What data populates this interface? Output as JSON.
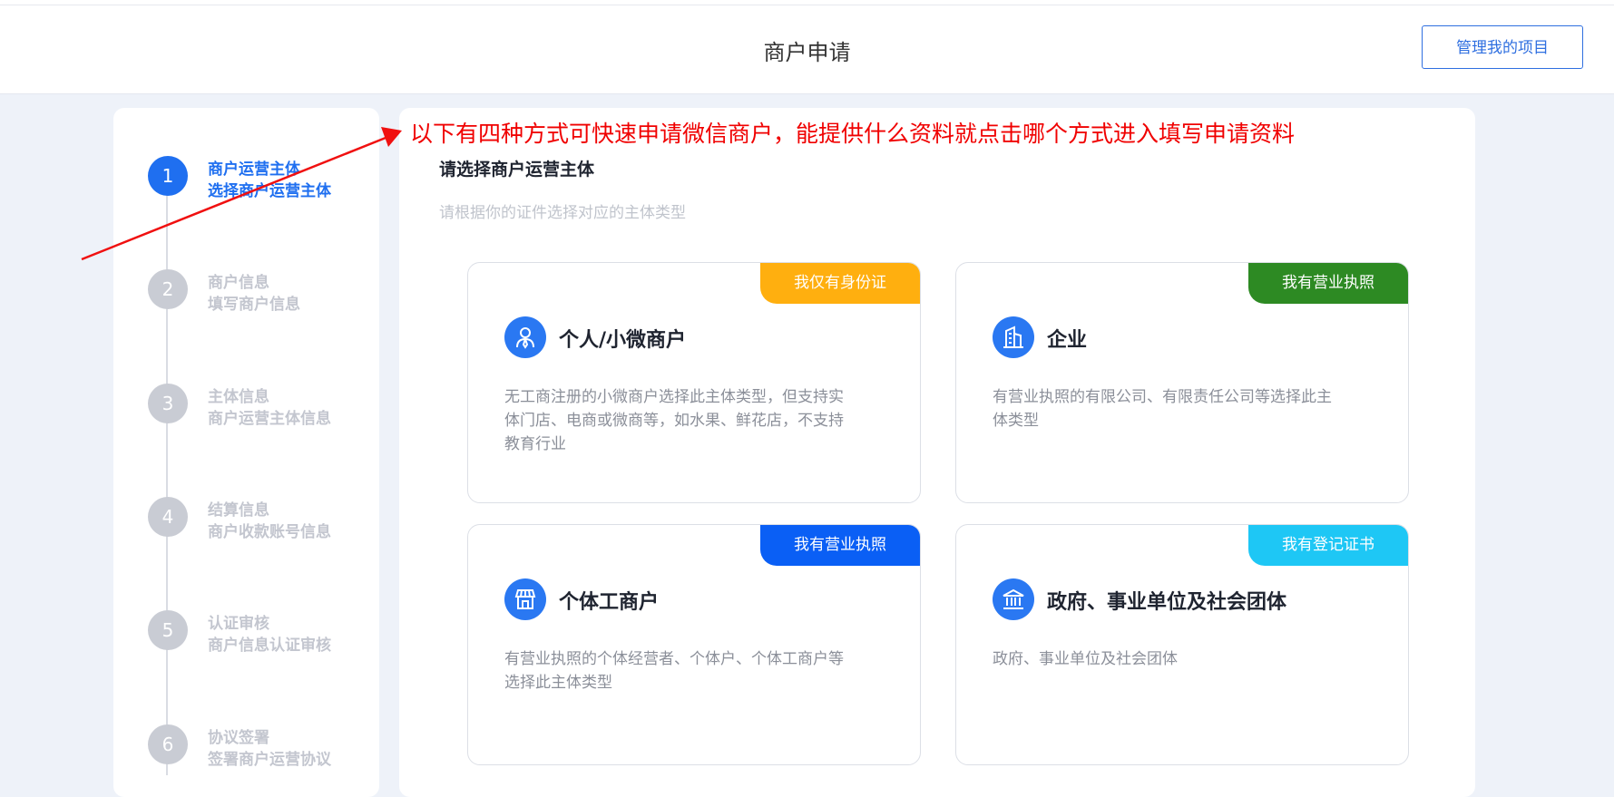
{
  "header": {
    "title": "商户申请",
    "manage_button": "管理我的项目"
  },
  "steps": [
    {
      "number": "1",
      "title": "商户运营主体",
      "subtitle": "选择商户运营主体",
      "active": true
    },
    {
      "number": "2",
      "title": "商户信息",
      "subtitle": "填写商户信息",
      "active": false
    },
    {
      "number": "3",
      "title": "主体信息",
      "subtitle": "商户运营主体信息",
      "active": false
    },
    {
      "number": "4",
      "title": "结算信息",
      "subtitle": "商户收款账号信息",
      "active": false
    },
    {
      "number": "5",
      "title": "认证审核",
      "subtitle": "商户信息认证审核",
      "active": false
    },
    {
      "number": "6",
      "title": "协议签署",
      "subtitle": "签署商户运营协议",
      "active": false
    }
  ],
  "annotation": "以下有四种方式可快速申请微信商户，能提供什么资料就点击哪个方式进入填写申请资料",
  "main": {
    "title": "请选择商户运营主体",
    "hint": "请根据你的证件选择对应的主体类型"
  },
  "cards": [
    {
      "badge": "我仅有身份证",
      "badge_color": "#ffaf0f",
      "title": "个人/小微商户",
      "icon": "person-icon",
      "description": "无工商注册的小微商户选择此主体类型，但支持实体门店、电商或微商等，如水果、鲜花店，不支持教育行业"
    },
    {
      "badge": "我有营业执照",
      "badge_color": "#2d8a23",
      "title": "企业",
      "icon": "building-icon",
      "description": "有营业执照的有限公司、有限责任公司等选择此主体类型"
    },
    {
      "badge": "我有营业执照",
      "badge_color": "#0a5ff5",
      "title": "个体工商户",
      "icon": "shop-icon",
      "description": "有营业执照的个体经营者、个体户、个体工商户等选择此主体类型"
    },
    {
      "badge": "我有登记证书",
      "badge_color": "#1ec7f5",
      "title": "政府、事业单位及社会团体",
      "icon": "government-icon",
      "description": "政府、事业单位及社会团体"
    }
  ]
}
